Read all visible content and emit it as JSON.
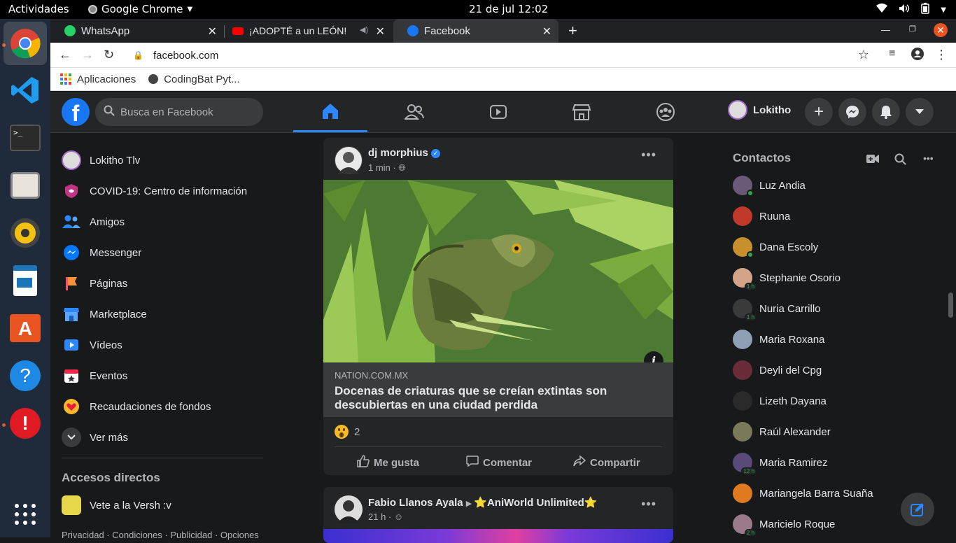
{
  "system": {
    "activities": "Actividades",
    "app_menu": "Google Chrome",
    "clock": "21 de jul  12:02"
  },
  "browser": {
    "tabs": [
      {
        "title": "WhatsApp",
        "color": "#25d366"
      },
      {
        "title": "¡ADOPTÉ a un LEÓN!",
        "color": "#ff0000"
      },
      {
        "title": "Facebook",
        "color": "#1877f2"
      }
    ],
    "url": "facebook.com",
    "bookmarks": [
      "Aplicaciones",
      "CodingBat Pyt..."
    ]
  },
  "fb": {
    "logo": "f",
    "search_placeholder": "Busca en Facebook",
    "profile_name": "Lokitho",
    "left_menu": [
      {
        "label": "Lokitho Tlv",
        "icon": "avatar"
      },
      {
        "label": "COVID-19: Centro de información",
        "icon": "covid-icon"
      },
      {
        "label": "Amigos",
        "icon": "friends-icon"
      },
      {
        "label": "Messenger",
        "icon": "messenger-icon"
      },
      {
        "label": "Páginas",
        "icon": "pages-icon"
      },
      {
        "label": "Marketplace",
        "icon": "marketplace-icon"
      },
      {
        "label": "Vídeos",
        "icon": "videos-icon"
      },
      {
        "label": "Eventos",
        "icon": "events-icon"
      },
      {
        "label": "Recaudaciones de fondos",
        "icon": "fundraiser-icon"
      },
      {
        "label": "Ver más",
        "icon": "chevron-down-icon"
      }
    ],
    "shortcuts_title": "Accesos directos",
    "shortcuts": [
      {
        "label": "Vete a la Versh :v"
      }
    ],
    "footer": "Privacidad · Condiciones · Publicidad · Opciones",
    "posts": [
      {
        "author": "dj morphius",
        "time": "1 min",
        "link_domain": "NATION.COM.MX",
        "link_title": "Docenas de criaturas que se creían extintas son descubiertas en una ciudad perdida",
        "reaction_count": "2",
        "actions": [
          "Me gusta",
          "Comentar",
          "Compartir"
        ]
      },
      {
        "author": "Fabio Llanos Ayala",
        "group": "⭐AniWorld Unlimited⭐",
        "time": "21 h"
      }
    ],
    "contacts_title": "Contactos",
    "contacts": [
      {
        "name": "Luz Andia",
        "status": "online",
        "color": "#6a5a7a"
      },
      {
        "name": "Ruuna",
        "status": "",
        "color": "#c0392b"
      },
      {
        "name": "Dana Escoly",
        "status": "online",
        "color": "#c8902c"
      },
      {
        "name": "Stephanie Osorio",
        "status": "1 h",
        "color": "#d4a48a"
      },
      {
        "name": "Nuria Carrillo",
        "status": "1 h",
        "color": "#3a3a3a"
      },
      {
        "name": "Maria Roxana",
        "status": "",
        "color": "#8ea0b4"
      },
      {
        "name": "Deyli del Cpg",
        "status": "",
        "color": "#6b2c3a"
      },
      {
        "name": "Lizeth Dayana",
        "status": "",
        "color": "#2a2a2a"
      },
      {
        "name": "Raúl Alexander",
        "status": "",
        "color": "#7a7a5a"
      },
      {
        "name": "Maria Ramirez",
        "status": "12 h",
        "color": "#5a4a7a"
      },
      {
        "name": "Mariangela Barra Suaña",
        "status": "",
        "color": "#e07a20"
      },
      {
        "name": "Maricielo Roque",
        "status": "2 h",
        "color": "#9a7a8a"
      }
    ]
  }
}
